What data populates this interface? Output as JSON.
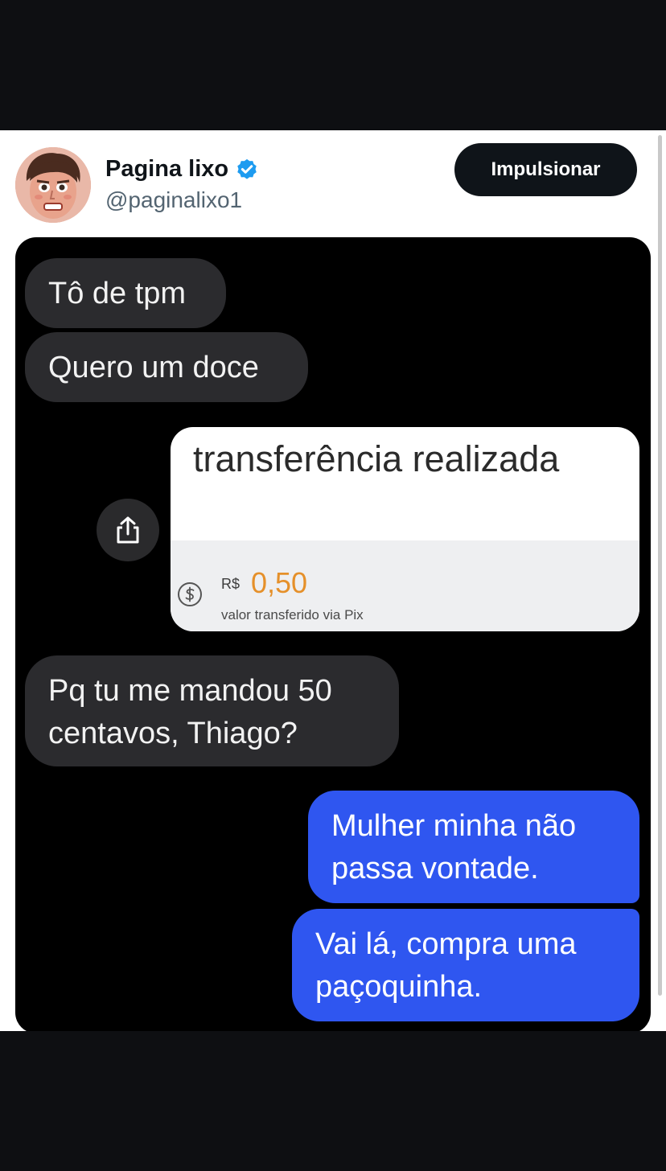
{
  "post": {
    "display_name": "Pagina lixo",
    "handle": "@paginalixo1",
    "boost_label": "Impulsionar"
  },
  "chat": {
    "messages": [
      {
        "side": "received",
        "text": "Tô de tpm"
      },
      {
        "side": "received",
        "text": "Quero um doce"
      },
      {
        "side": "received",
        "text": "Pq tu me mandou 50 centavos, Thiago?"
      },
      {
        "side": "sent",
        "text": "Mulher minha não passa vontade."
      },
      {
        "side": "sent",
        "text": "Vai lá, compra uma paçoquinha."
      }
    ],
    "transfer": {
      "title": "transferência realizada",
      "currency": "R$",
      "amount": "0,50",
      "caption": "valor transferido via Pix"
    }
  },
  "colors": {
    "verified_badge": "#1d9bf0",
    "sent_bubble": "#2f56f0",
    "received_bubble": "#2b2b2e",
    "amount": "#e5902a"
  },
  "icons": [
    "verified-badge-icon",
    "share-icon",
    "money-icon"
  ]
}
